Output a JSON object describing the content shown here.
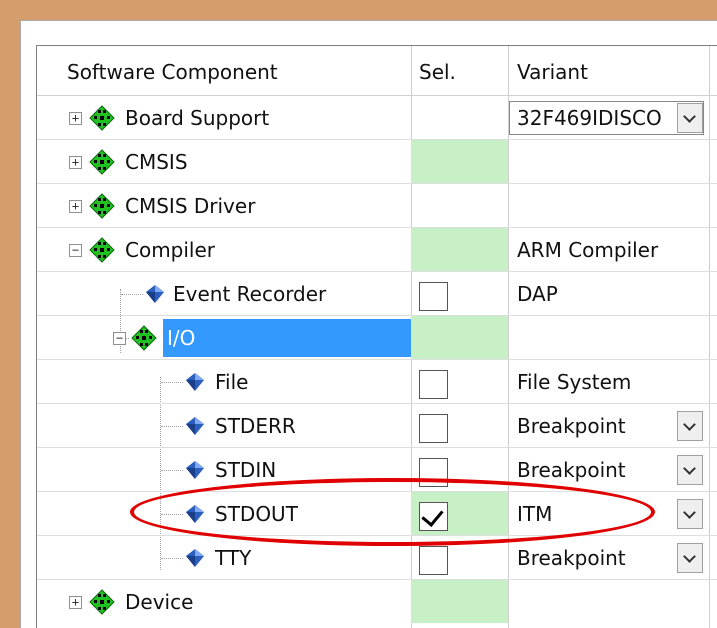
{
  "header": {
    "col_component": "Software Component",
    "col_sel": "Sel.",
    "col_variant": "Variant"
  },
  "rows": [
    {
      "label": "Board Support",
      "variant": "32F469IDISCO",
      "expander": "+"
    },
    {
      "label": "CMSIS",
      "variant": "",
      "expander": "+"
    },
    {
      "label": "CMSIS Driver",
      "variant": "",
      "expander": "+"
    },
    {
      "label": "Compiler",
      "variant": "ARM Compiler",
      "expander": "−"
    },
    {
      "label": "Event Recorder",
      "variant": "DAP"
    },
    {
      "label": "I/O",
      "variant": "",
      "expander": "−"
    },
    {
      "label": "File",
      "variant": "File System"
    },
    {
      "label": "STDERR",
      "variant": "Breakpoint"
    },
    {
      "label": "STDIN",
      "variant": "Breakpoint"
    },
    {
      "label": "STDOUT",
      "variant": "ITM"
    },
    {
      "label": "TTY",
      "variant": "Breakpoint"
    },
    {
      "label": "Device",
      "variant": "",
      "expander": "+"
    }
  ],
  "colors": {
    "selected_green": "#c7f0c7",
    "highlight": "#3399ff",
    "annotation": "#e00000"
  },
  "icons": {
    "component_group": "green-diamond-icon",
    "component_item": "blue-gem-icon",
    "dropdown": "chevron-down-icon"
  }
}
